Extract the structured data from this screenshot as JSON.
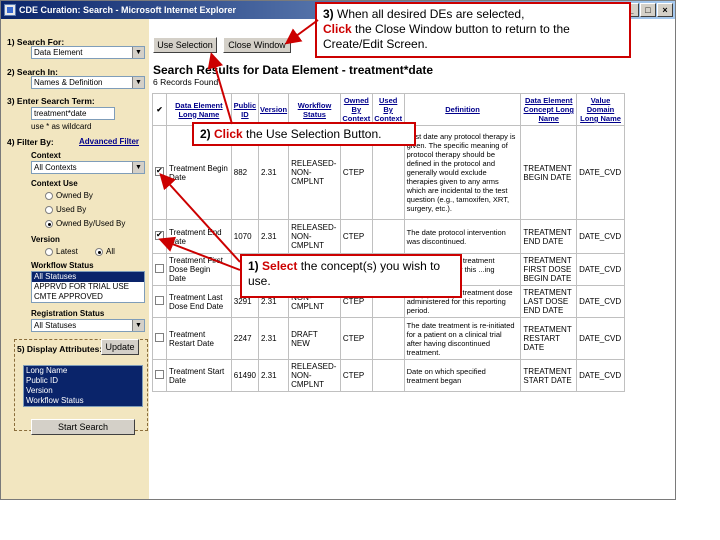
{
  "window": {
    "title": "CDE Curation: Search - Microsoft Internet Explorer",
    "buttons": [
      "_",
      "□",
      "×"
    ]
  },
  "left_panel": {
    "search_for_label": "1) Search For:",
    "search_for_value": "Data Element",
    "search_in_label": "2) Search In:",
    "search_in_value": "Names & Definition",
    "term_label": "3) Enter Search Term:",
    "term_value": "treatment*date",
    "wildcard_hint": "use * as wildcard",
    "filter_label": "4) Filter By:",
    "advanced_filter": "Advanced Filter",
    "context_label": "Context",
    "context_value": "All Contexts",
    "context_use_label": "Context Use",
    "context_use_options": [
      "Owned By",
      "Used By",
      "Owned By/Used By"
    ],
    "version_label": "Version",
    "version_options": [
      "Latest",
      "All"
    ],
    "workflow_label": "Workflow Status",
    "workflow_options": [
      "All Statuses",
      "APPRVD FOR TRIAL USE",
      "CMTE APPROVED"
    ],
    "registration_label": "Registration Status",
    "registration_value": "All Statuses",
    "display_attr_label": "5)  Display Attributes:",
    "update_button": "Update",
    "attr_options": [
      "Long Name",
      "Public ID",
      "Version",
      "Workflow Status"
    ],
    "start_search": "Start Search"
  },
  "toolbar": {
    "use_selection": "Use Selection",
    "close_window": "Close Window"
  },
  "results": {
    "heading": "Search Results for Data Element - treatment*date",
    "count": "6 Records Found",
    "columns": [
      "✔",
      "Data Element Long Name",
      "Public ID",
      "Version",
      "Workflow Status",
      "Owned By Context",
      "Used By Context",
      "Definition",
      "Data Element Concept Long Name",
      "Value Domain Long Name"
    ],
    "rows": [
      {
        "checked": true,
        "name": "Treatment Begin Date",
        "id": "882",
        "version": "2.31",
        "status": "RELEASED-NON-CMPLNT",
        "owned": "CTEP",
        "used": "",
        "definition": "First date any protocol therapy is given. The specific meaning of protocol therapy should be defined in the protocol and generally would exclude therapies given to any arms which are incidental to the test question (e.g., tamoxifen, XRT, surgery, etc.).",
        "concept": "TREATMENT BEGIN DATE",
        "vd": "DATE_CVD"
      },
      {
        "checked": true,
        "name": "Treatment End Date",
        "id": "1070",
        "version": "2.31",
        "status": "RELEASED-NON-CMPLNT",
        "owned": "CTEP",
        "used": "",
        "definition": "The date protocol intervention was discontinued.",
        "concept": "TREATMENT END DATE",
        "vd": "DATE_CVD"
      },
      {
        "checked": false,
        "name": "Treatment First Dose Begin Date",
        "id": "",
        "version": "",
        "status": "",
        "owned": "",
        "used": "",
        "definition": "...ate for the first treatment ...dministered for this ...ing period.",
        "concept": "TREATMENT FIRST DOSE BEGIN DATE",
        "vd": "DATE_CVD"
      },
      {
        "checked": false,
        "name": "Treatment Last Dose End Date",
        "id": "3291",
        "version": "2.31",
        "status": "NON-CMPLNT",
        "owned": "CTEP",
        "used": "",
        "definition": "...ate for the last treatment dose administered for this reporting period.",
        "concept": "TREATMENT LAST DOSE END DATE",
        "vd": "DATE_CVD"
      },
      {
        "checked": false,
        "name": "Treatment Restart Date",
        "id": "2247",
        "version": "2.31",
        "status": "DRAFT NEW",
        "owned": "CTEP",
        "used": "",
        "definition": "The date treatment is re-initiated for a patient on a clinical trial after having discontinued treatment.",
        "concept": "TREATMENT RESTART DATE",
        "vd": "DATE_CVD"
      },
      {
        "checked": false,
        "name": "Treatment Start Date",
        "id": "61490",
        "version": "2.31",
        "status": "RELEASED-NON-CMPLNT",
        "owned": "CTEP",
        "used": "",
        "definition": "Date on which specified treatment began",
        "concept": "TREATMENT START DATE",
        "vd": "DATE_CVD"
      }
    ]
  },
  "callouts": {
    "c3_num": "3)",
    "c3_a": " When all desired DEs are selected,",
    "c3_red": "Click",
    "c3_b": " the Close Window button to return to the Create/Edit Screen.",
    "c2_num": "2)",
    "c2_red": "Click",
    "c2_b": " the Use Selection Button.",
    "c1_num": "1)",
    "c1_red": "Select",
    "c1_b": " the concept(s) you wish to use."
  },
  "colors": {
    "accent": "#cc0000",
    "panel": "#f2e6c0",
    "title": "#0a246a"
  }
}
